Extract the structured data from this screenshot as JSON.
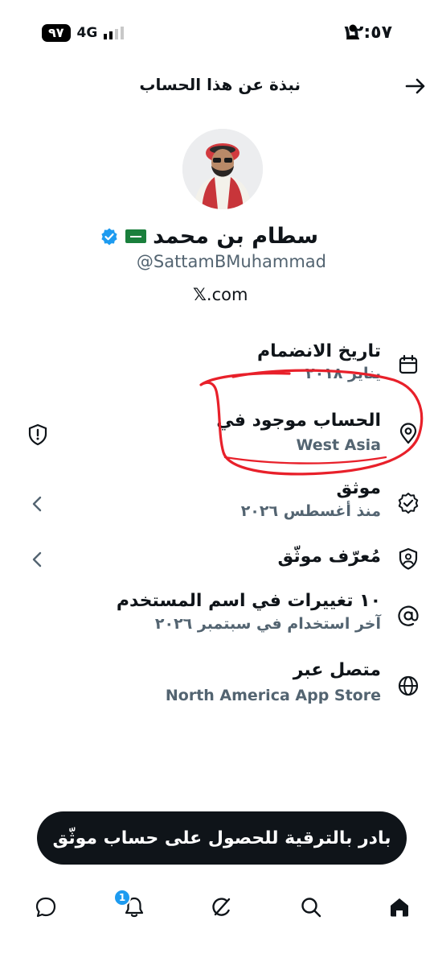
{
  "status_bar": {
    "time": "١٢:٥٧",
    "battery": "٩٧",
    "network": "4G"
  },
  "header": {
    "title": "نبذة عن هذا الحساب"
  },
  "profile": {
    "name": "سطام بن محمد",
    "handle": "@SattamBMuhammad",
    "website_suffix": ".com",
    "website_x": "𝕏"
  },
  "rows": [
    {
      "title": "تاريخ الانضمام",
      "value": "يناير ٢٠١٨",
      "icon": "calendar-icon"
    },
    {
      "title": "الحساب موجود في",
      "value": "West Asia",
      "icon": "location-pin-icon"
    },
    {
      "title": "موثق",
      "value": "منذ أغسطس ٢٠٢٦",
      "icon": "verified-badge-icon"
    },
    {
      "title": "مُعرّف موثّق",
      "value": "",
      "icon": "id-shield-icon"
    },
    {
      "title": "١٠ تغييرات في اسم المستخدم",
      "value": "آخر استخدام في سبتمبر ٢٠٢٦",
      "icon": "at-sign-icon"
    },
    {
      "title": "متصل عبر",
      "value": "North America App Store",
      "icon": "globe-icon"
    }
  ],
  "cta": {
    "label": "بادر بالترقية للحصول على حساب موثّق"
  },
  "nav": {
    "notification_count": "1"
  },
  "colors": {
    "accent": "#1d9bf0",
    "annotation": "#e8202a",
    "muted": "#536471"
  }
}
